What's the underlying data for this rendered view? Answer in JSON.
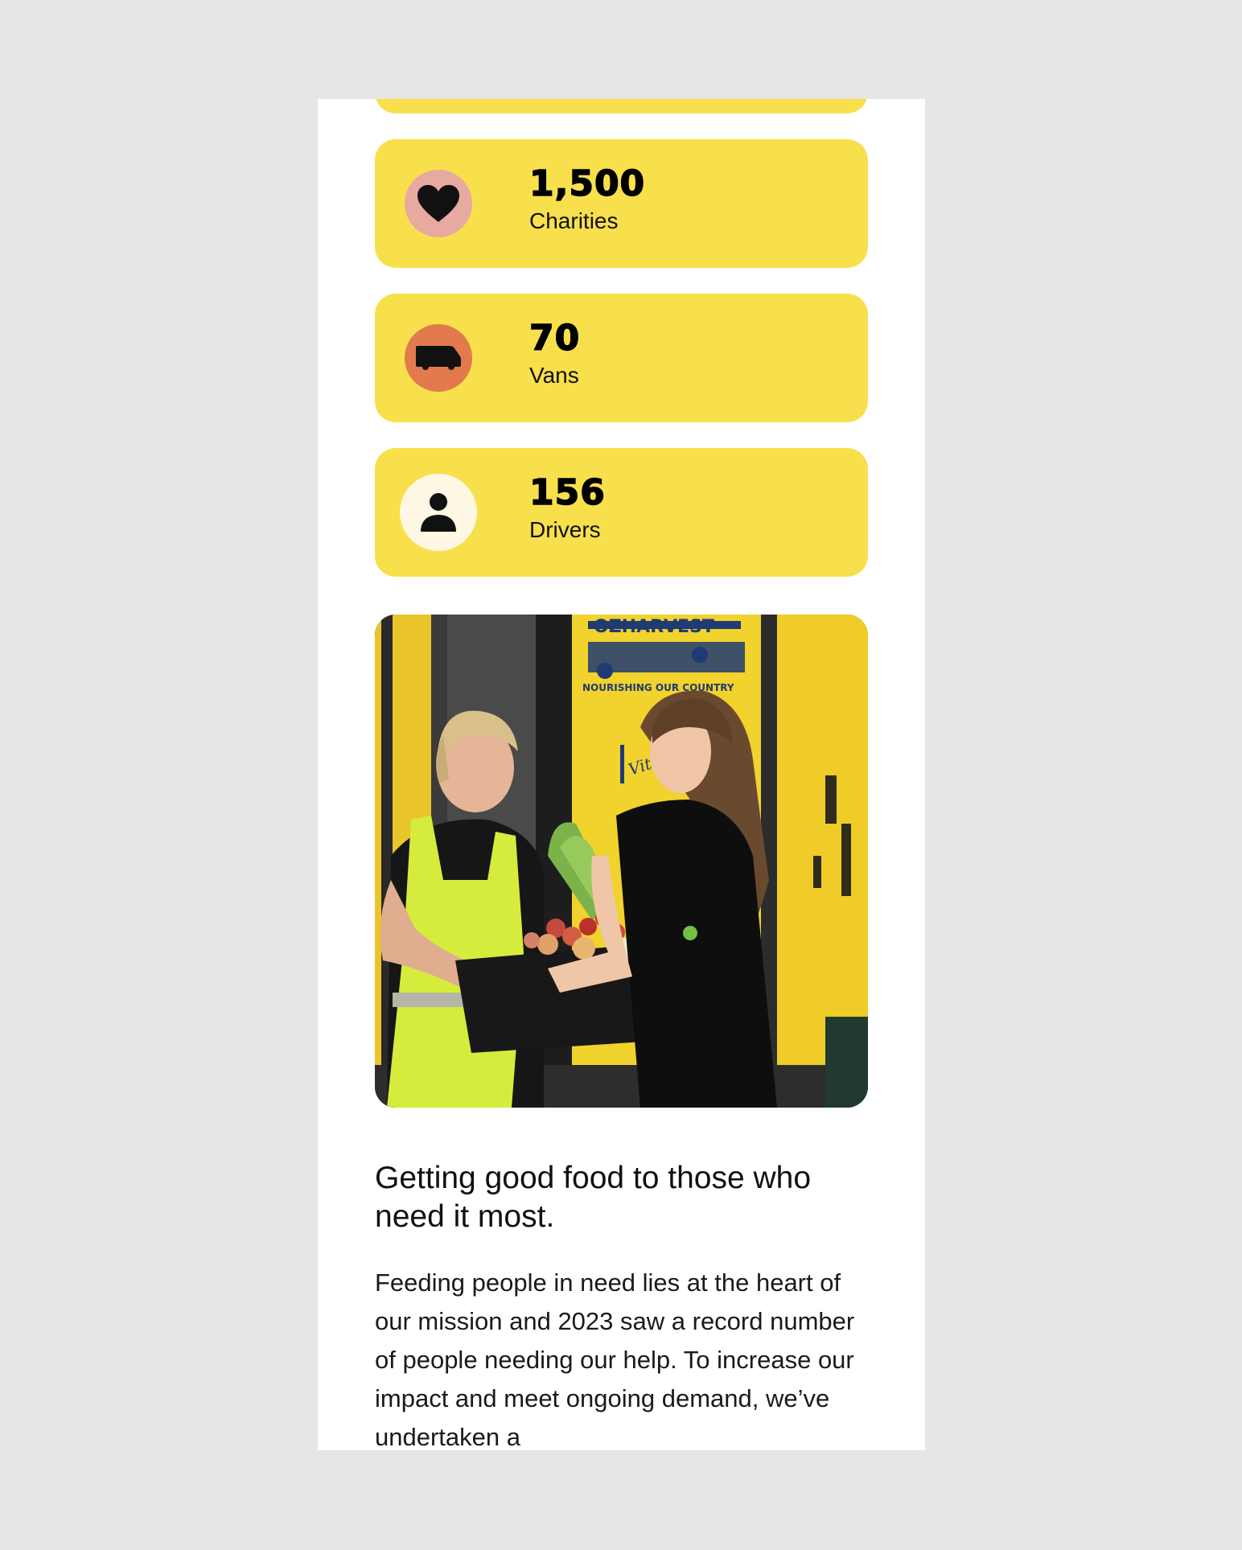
{
  "stats": [
    {
      "value": "1,500",
      "label": "Charities",
      "icon": "heart-icon",
      "icon_bg": "#e8a9a0"
    },
    {
      "value": "70",
      "label": "Vans",
      "icon": "van-icon",
      "icon_bg": "#e27a4e"
    },
    {
      "value": "156",
      "label": "Drivers",
      "icon": "person-icon",
      "icon_bg": "#fdf7e3"
    }
  ],
  "colors": {
    "card_bg": "#f8e04d",
    "page_bg": "#ffffff",
    "outer_bg": "#e6e6e6",
    "text": "#111111"
  },
  "photo": {
    "van_logo": "OZHARVEST",
    "van_tagline": "NOURISHING OUR COUNTRY",
    "sponsor": "Vittoria Coffee"
  },
  "content": {
    "headline": "Getting good food to those who need it most.",
    "body": "Feeding people in need lies at the heart of our mission and 2023 saw a record number of people needing our help. To increase our impact and meet ongoing demand, we’ve undertaken a"
  }
}
